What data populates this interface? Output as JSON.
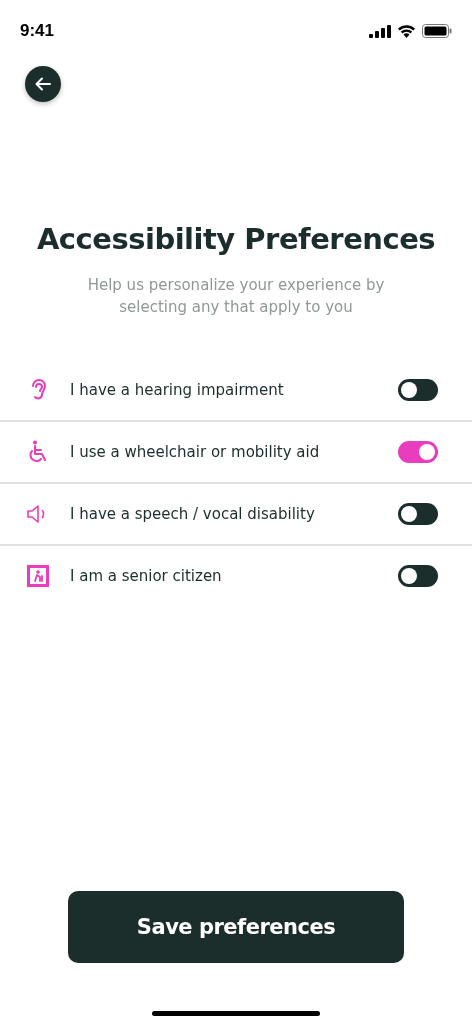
{
  "status_bar": {
    "time": "9:41"
  },
  "title": "Accessibility Preferences",
  "subtitle": "Help us personalize your experience by selecting any that apply to you",
  "options": [
    {
      "kind": "ear",
      "label": "I have a hearing impairment",
      "on": false
    },
    {
      "kind": "wheelchair",
      "label": "I use a wheelchair or mobility aid",
      "on": true
    },
    {
      "kind": "speaker",
      "label": "I have a speech / vocal disability",
      "on": false
    },
    {
      "kind": "senior",
      "label": "I am a senior citizen",
      "on": false
    }
  ],
  "save_button": "Save preferences"
}
